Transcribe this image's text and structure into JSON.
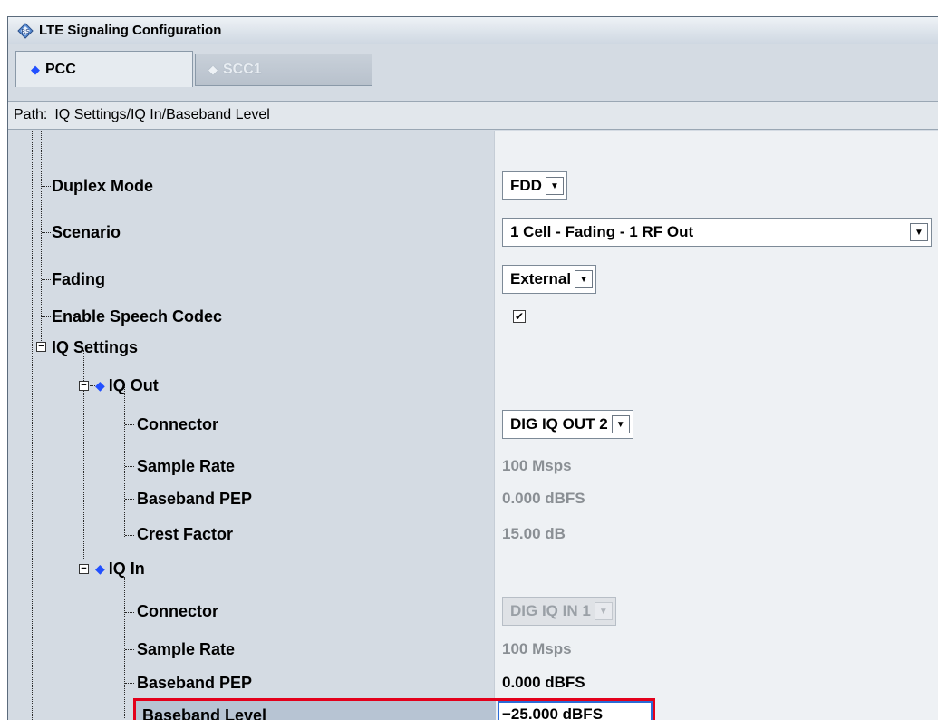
{
  "window": {
    "title": "LTE Signaling Configuration"
  },
  "tabs": [
    {
      "label": "PCC",
      "active": true
    },
    {
      "label": "SCC1",
      "active": false
    }
  ],
  "path": {
    "label": "Path:",
    "value": "IQ Settings/IQ In/Baseband Level"
  },
  "rows": {
    "duplex_mode": {
      "label": "Duplex Mode",
      "value": "FDD"
    },
    "scenario": {
      "label": "Scenario",
      "value": "1 Cell - Fading - 1 RF Out"
    },
    "fading": {
      "label": "Fading",
      "value": "External"
    },
    "enable_speech_codec": {
      "label": "Enable Speech Codec",
      "checked": true
    },
    "iq_settings": {
      "label": "IQ Settings"
    },
    "iq_out": {
      "label": "IQ Out",
      "connector": {
        "label": "Connector",
        "value": "DIG IQ OUT 2"
      },
      "sample_rate": {
        "label": "Sample Rate",
        "value": "100 Msps"
      },
      "baseband_pep": {
        "label": "Baseband PEP",
        "value": "0.000 dBFS"
      },
      "crest_factor": {
        "label": "Crest Factor",
        "value": "15.00 dB"
      }
    },
    "iq_in": {
      "label": "IQ In",
      "connector": {
        "label": "Connector",
        "value": "DIG IQ IN 1"
      },
      "sample_rate": {
        "label": "Sample Rate",
        "value": "100 Msps"
      },
      "baseband_pep": {
        "label": "Baseband PEP",
        "value": "0.000 dBFS"
      },
      "baseband_level": {
        "label": "Baseband Level",
        "value": "−25.000 dBFS"
      }
    }
  },
  "colors": {
    "accent_diamond": "#2250ff",
    "highlight_border": "#e3001b",
    "panel_bg": "#d4dbe3"
  }
}
